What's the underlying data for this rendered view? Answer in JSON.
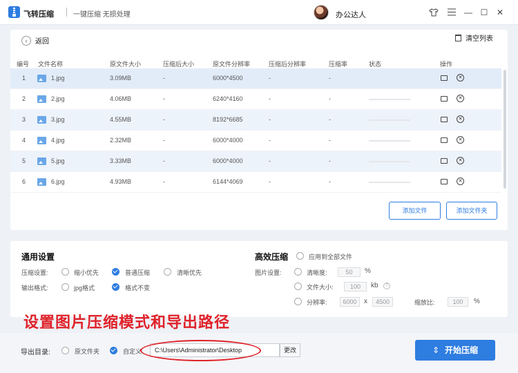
{
  "titlebar": {
    "app_title": "飞转压缩",
    "subtitle": "一键压缩 无损处理",
    "username": "办公达人",
    "skin_icon": "shirt-icon",
    "menu_icon": "hamburger-icon",
    "min_icon": "—",
    "max_icon": "☐",
    "close_icon": "✕"
  },
  "toolbar": {
    "back_label": "返回",
    "clear_label": "清空列表"
  },
  "table": {
    "headers": [
      "编号",
      "文件名称",
      "原文件大小",
      "压缩后大小",
      "原文件分辨率",
      "压缩后分辨率",
      "压缩率",
      "状态",
      "操作"
    ],
    "rows": [
      {
        "num": "1",
        "name": "1.jpg",
        "size": "3.09MB",
        "csize": "-",
        "res": "6000*4500",
        "cres": "-",
        "rate": "-"
      },
      {
        "num": "2",
        "name": "2.jpg",
        "size": "4.06MB",
        "csize": "-",
        "res": "6240*4160",
        "cres": "-",
        "rate": "-"
      },
      {
        "num": "3",
        "name": "3.jpg",
        "size": "4.55MB",
        "csize": "-",
        "res": "8192*6685",
        "cres": "-",
        "rate": "-"
      },
      {
        "num": "4",
        "name": "4.jpg",
        "size": "2.32MB",
        "csize": "-",
        "res": "6000*4000",
        "cres": "-",
        "rate": "-"
      },
      {
        "num": "5",
        "name": "5.jpg",
        "size": "3.33MB",
        "csize": "-",
        "res": "6000*4000",
        "cres": "-",
        "rate": "-"
      },
      {
        "num": "6",
        "name": "6.jpg",
        "size": "4.93MB",
        "csize": "-",
        "res": "6144*4069",
        "cres": "-",
        "rate": "-"
      }
    ]
  },
  "buttons": {
    "add_file": "添加文件",
    "add_folder": "添加文件夹",
    "change": "更改",
    "start": "开始压缩"
  },
  "general": {
    "title": "通用设置",
    "compress_label": "压缩设置:",
    "compress_options": [
      "缩小优先",
      "普通压缩",
      "清晰优先"
    ],
    "format_label": "输出格式:",
    "format_options": [
      "jpg格式",
      "格式不变"
    ]
  },
  "advanced": {
    "title": "高效压缩",
    "apply_all": "应用到全部文件",
    "image_label": "图片设置:",
    "clarity_label": "清晰度:",
    "clarity_value": "50",
    "clarity_unit": "%",
    "filesize_label": "文件大小:",
    "filesize_value": "100",
    "filesize_unit": "kb",
    "help": "?",
    "resolution_label": "分辨率:",
    "res_w": "6000",
    "res_x": "x",
    "res_h": "4500",
    "scale_label": "缩放比:",
    "scale_value": "100",
    "scale_unit": "%"
  },
  "annotation": "设置图片压缩模式和导出路径",
  "export": {
    "label": "导出目录:",
    "option_source": "原文件夹",
    "option_custom": "自定义",
    "path": "C:\\Users\\Administrator\\Desktop"
  },
  "colors": {
    "accent": "#2e7de0",
    "annotation": "#e0222a"
  }
}
